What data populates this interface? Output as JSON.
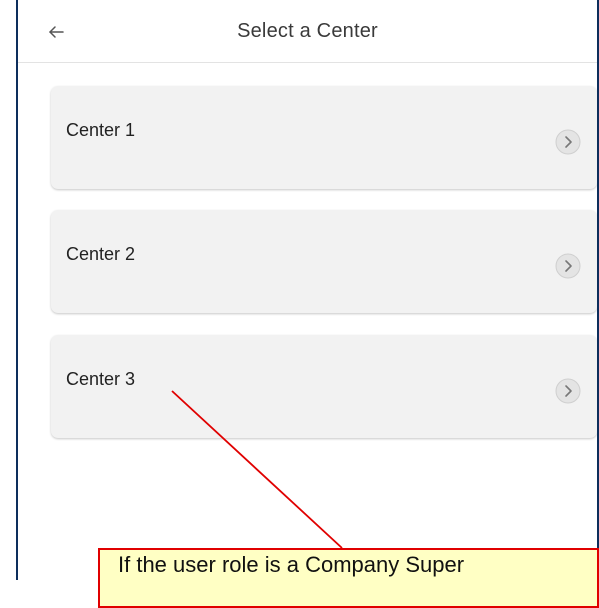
{
  "header": {
    "title": "Select a Center",
    "back_icon": "arrow-left-icon"
  },
  "centers": [
    {
      "label": "Center 1",
      "icon": "chevron-right-circle-icon"
    },
    {
      "label": "Center 2",
      "icon": "chevron-right-circle-icon"
    },
    {
      "label": "Center 3",
      "icon": "chevron-right-circle-icon"
    }
  ],
  "callout": {
    "text": "If the user role is a Company Super",
    "background": "#ffffc4",
    "border_color": "#e00000"
  },
  "colors": {
    "frame_border": "#0d2e5c",
    "card_background": "#f2f2f2"
  }
}
